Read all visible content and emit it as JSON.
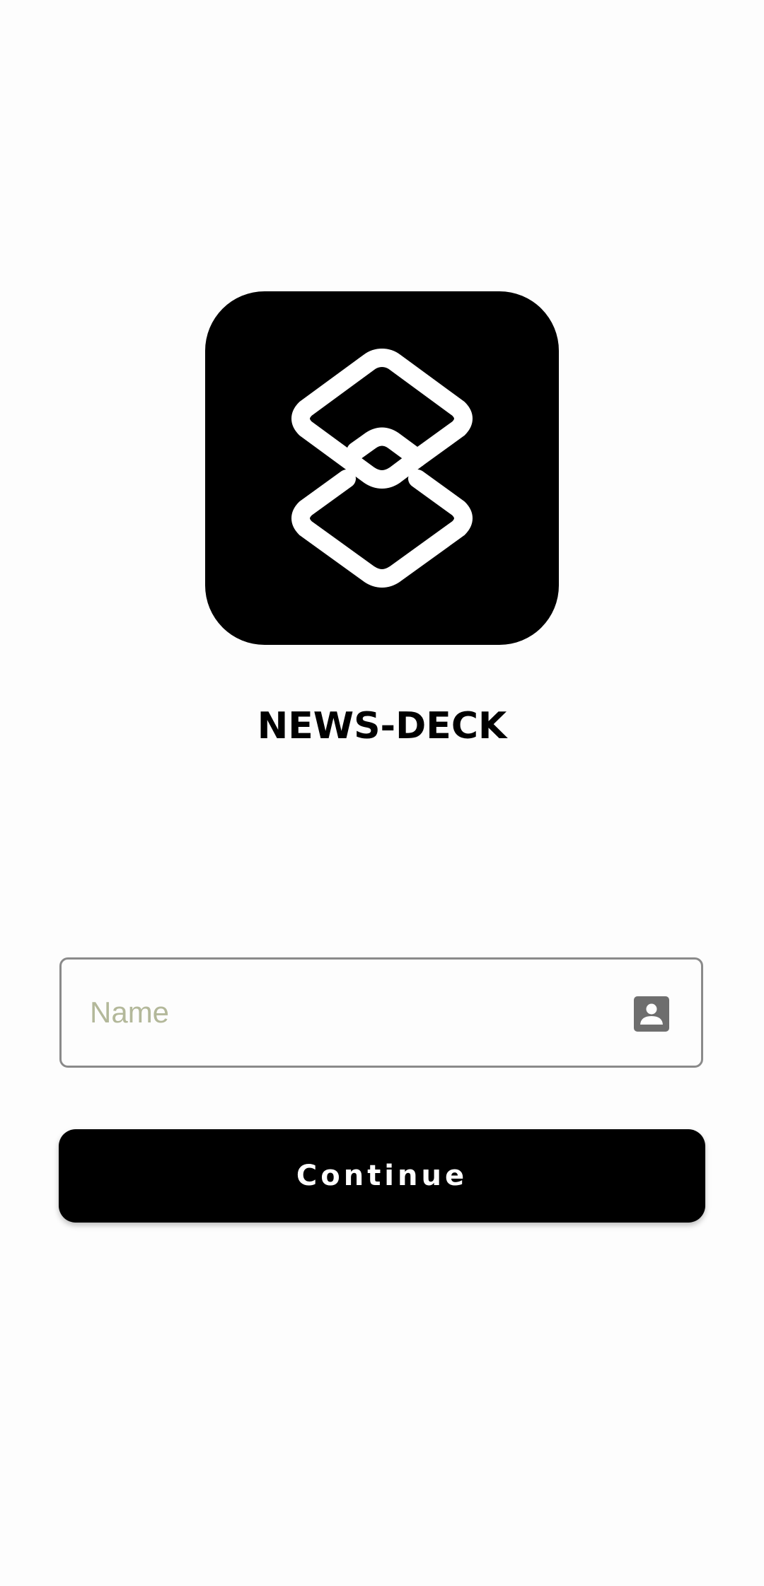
{
  "app": {
    "name": "NEWS-DECK"
  },
  "logo": {
    "icon": "news-deck-logo-icon",
    "background_color": "#000000",
    "foreground_color": "#ffffff"
  },
  "form": {
    "name_input": {
      "placeholder": "Name",
      "value": "",
      "icon": "contact-card-icon"
    },
    "continue_button": {
      "label": "Continue",
      "color": "#000000",
      "text_color": "#ffffff"
    }
  }
}
